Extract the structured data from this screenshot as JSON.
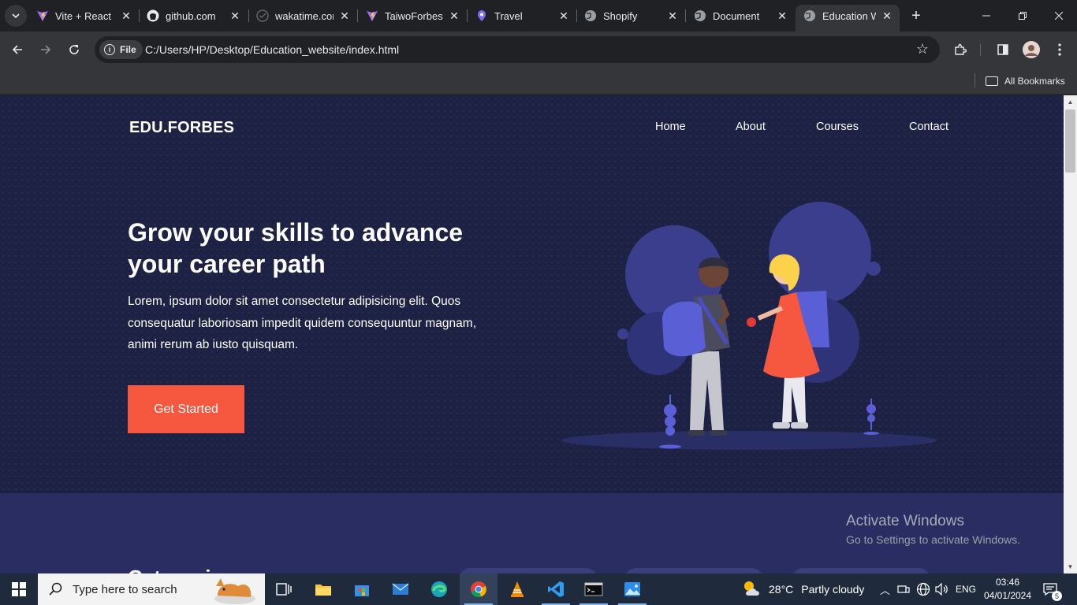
{
  "browser": {
    "tabs": [
      {
        "label": "Vite + React",
        "icon": "vite-icon"
      },
      {
        "label": "github.com",
        "icon": "github-icon"
      },
      {
        "label": "wakatime.com",
        "icon": "wakatime-icon"
      },
      {
        "label": "TaiwoForbes",
        "icon": "vite-icon"
      },
      {
        "label": "Travel",
        "icon": "travel-icon"
      },
      {
        "label": "Shopify",
        "icon": "globe-icon"
      },
      {
        "label": "Document",
        "icon": "globe-icon"
      },
      {
        "label": "Education W",
        "icon": "globe-icon",
        "active": true
      }
    ],
    "address": {
      "chip": "File",
      "url": "C:/Users/HP/Desktop/Education_website/index.html"
    },
    "bookmarks": {
      "all_label": "All Bookmarks"
    }
  },
  "page": {
    "logo": "EDU.FORBES",
    "nav": [
      "Home",
      "About",
      "Courses",
      "Contact"
    ],
    "hero": {
      "title": "Grow your skills to advance your career path",
      "text": "Lorem, ipsum dolor sit amet consectetur adipisicing elit. Quos consequatur laboriosam impedit quidem consequuntur magnam, animi rerum ab iusto quisquam.",
      "cta": "Get Started"
    },
    "section2_heading": "Categories"
  },
  "watermark": {
    "line1": "Activate Windows",
    "line2": "Go to Settings to activate Windows."
  },
  "taskbar": {
    "search_placeholder": "Type here to search",
    "weather": {
      "temp": "28°C",
      "condition": "Partly cloudy"
    },
    "language": "ENG",
    "time": "03:46",
    "date": "04/01/2024",
    "notifications": "5"
  },
  "colors": {
    "hero_bg": "#1d2143",
    "accent": "#f5573f",
    "section2_bg": "#2a2d62",
    "illustration_purple": "#5b5fd6"
  }
}
